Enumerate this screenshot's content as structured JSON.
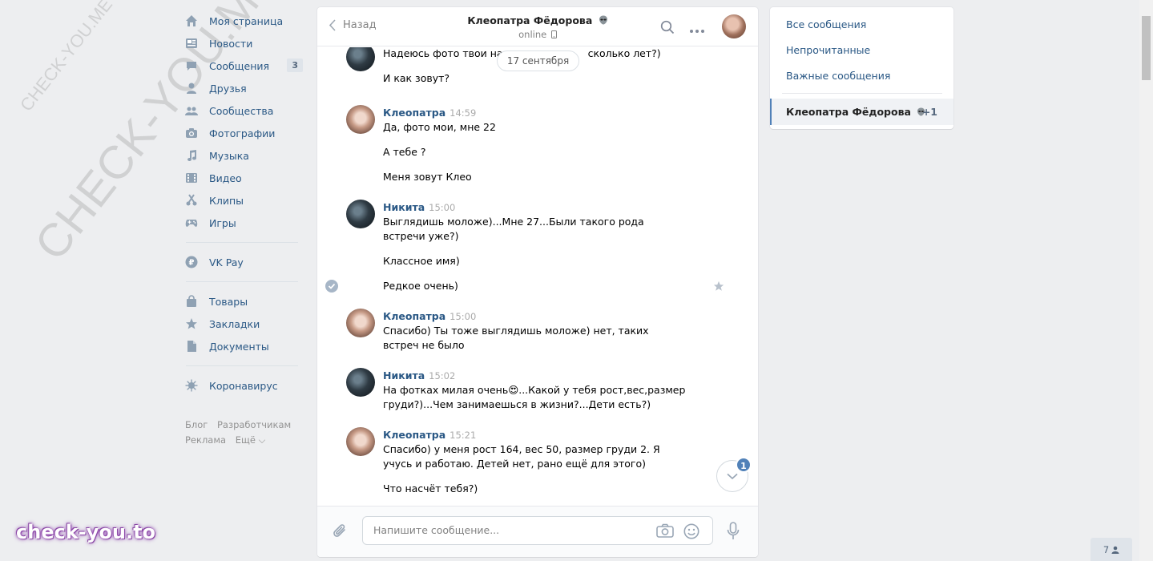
{
  "watermarks": {
    "diag_small": "CHECK-YOU.ME",
    "diag_big": "CHECK-YOU.ME",
    "corner": "check-you.to"
  },
  "nav": {
    "items": [
      {
        "label": "Моя страница",
        "icon": "home-icon"
      },
      {
        "label": "Новости",
        "icon": "news-icon"
      },
      {
        "label": "Сообщения",
        "icon": "messages-icon",
        "badge": "3"
      },
      {
        "label": "Друзья",
        "icon": "friends-icon"
      },
      {
        "label": "Сообщества",
        "icon": "groups-icon"
      },
      {
        "label": "Фотографии",
        "icon": "camera-icon"
      },
      {
        "label": "Музыка",
        "icon": "music-icon"
      },
      {
        "label": "Видео",
        "icon": "video-icon"
      },
      {
        "label": "Клипы",
        "icon": "clips-icon"
      },
      {
        "label": "Игры",
        "icon": "gamepad-icon"
      }
    ],
    "vkpay": "VK Pay",
    "items2": [
      {
        "label": "Товары",
        "icon": "shopping-bag-icon"
      },
      {
        "label": "Закладки",
        "icon": "star-icon"
      },
      {
        "label": "Документы",
        "icon": "document-icon"
      }
    ],
    "corona": "Коронавирус",
    "footer": {
      "blog": "Блог",
      "dev": "Разработчикам",
      "ads": "Реклама",
      "more": "Ещё ⌵"
    }
  },
  "chat": {
    "back": "Назад",
    "peer_name": "Клеопатра Фёдорова",
    "peer_status": "online",
    "date": "17 сентября",
    "partial": {
      "line1a": "Надеюсь фото твои на",
      "line1b": "сколько лет?)",
      "line2": "И как зовут?"
    },
    "groups": [
      {
        "author": "Клеопатра",
        "time": "14:59",
        "avatar": "kleo",
        "texts": [
          "Да, фото мои, мне 22",
          "А тебе ?",
          "Меня зовут Клео"
        ]
      },
      {
        "author": "Никита",
        "time": "15:00",
        "avatar": "nikita",
        "texts": [
          "Выглядишь моложе)...Мне 27...Были такого рода встречи уже?)",
          "Классное имя)",
          "Редкое очень)"
        ]
      },
      {
        "author": "Клеопатра",
        "time": "15:00",
        "avatar": "kleo",
        "texts": [
          "Спасибо) Ты тоже выглядишь моложе) нет, таких встреч не было"
        ]
      },
      {
        "author": "Никита",
        "time": "15:02",
        "avatar": "nikita",
        "texts": [
          "На фотках милая очень😍...Какой у тебя рост,вес,размер груди?)...Чем занимаешься в жизни?...Дети есть?)"
        ]
      },
      {
        "author": "Клеопатра",
        "time": "15:21",
        "avatar": "kleo",
        "texts": [
          "Спасибо) у меня рост 164, вес 50, размер груди 2. Я учусь и работаю. Детей нет, рано ещё для этого)",
          "Что насчёт тебя?)"
        ]
      }
    ],
    "unread_badge": "1",
    "composer_placeholder": "Напишите сообщение..."
  },
  "filters": {
    "all": "Все сообщения",
    "unread": "Непрочитанные",
    "important": "Важные сообщения",
    "active_name": "Клеопатра Фёдорова",
    "active_count": "+1"
  },
  "online_count": "7"
}
